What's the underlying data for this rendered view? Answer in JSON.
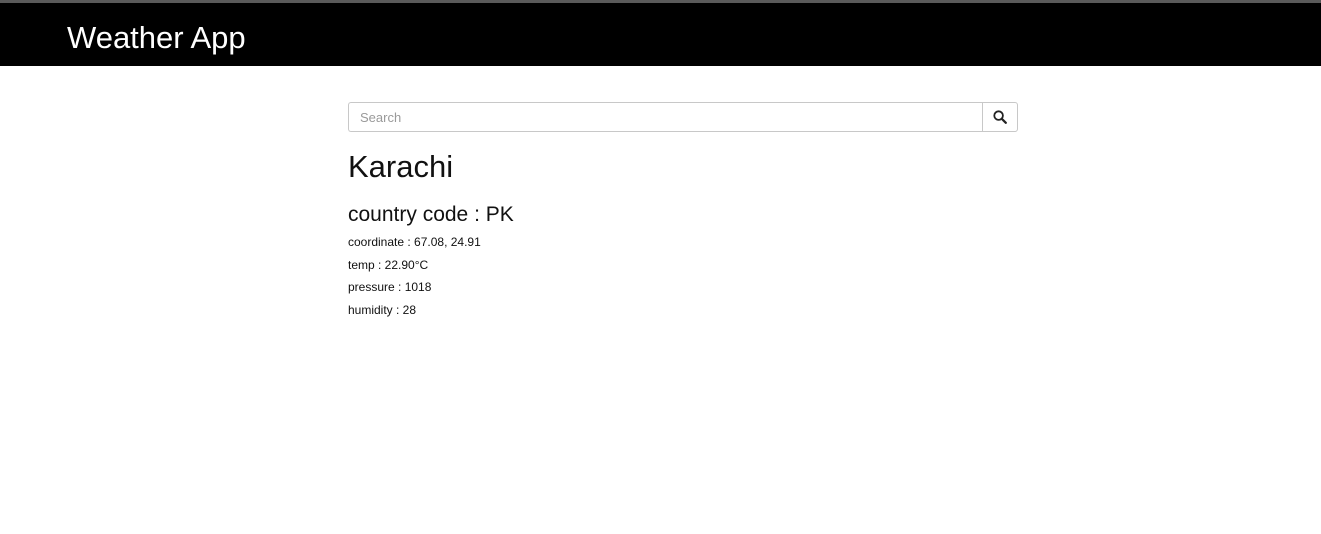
{
  "app": {
    "title": "Weather App"
  },
  "search": {
    "placeholder": "Search",
    "value": "",
    "button_icon": "search-icon"
  },
  "weather": {
    "city": "Karachi",
    "country_code": "country code : PK",
    "coordinate": "coordinate : 67.08, 24.91",
    "temp": "temp : 22.90°C",
    "pressure": "pressure : 1018",
    "humidity": "humidity : 28"
  }
}
